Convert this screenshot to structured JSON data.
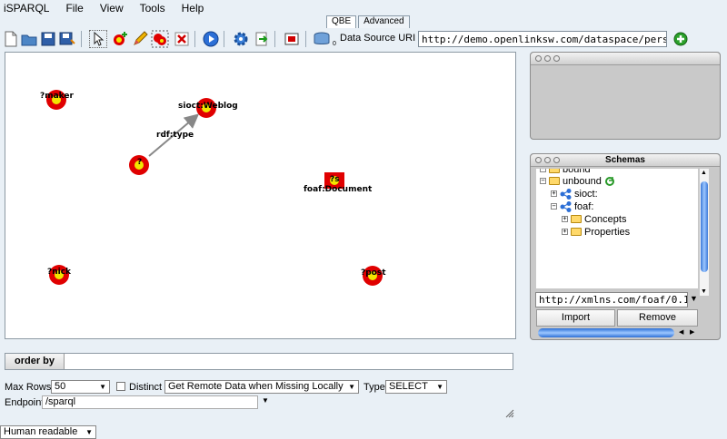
{
  "menu": [
    "iSPARQL",
    "File",
    "View",
    "Tools",
    "Help"
  ],
  "tabs": [
    {
      "label": "QBE"
    },
    {
      "label": "Advanced"
    }
  ],
  "toolbar": {
    "ds_label": "Data Source URI",
    "ds_uri": "http://demo.openlinksw.com/dataspace/person/dem",
    "ds_subscript": "0"
  },
  "graph": {
    "nodes": [
      {
        "label": "?maker"
      },
      {
        "label": "sioct:Weblog"
      },
      {
        "label": "?"
      },
      {
        "label": "?s"
      },
      {
        "label": "foaf:Document"
      },
      {
        "label": "?nick"
      },
      {
        "label": "?post"
      }
    ],
    "edge_label": "rdf:type"
  },
  "schemas": {
    "title": "Schemas",
    "tree": [
      {
        "label": "bound",
        "expander": "−",
        "partial": true
      },
      {
        "label": "unbound",
        "expander": "−"
      },
      {
        "label": "sioct:",
        "expander": "+"
      },
      {
        "label": "foaf:",
        "expander": "−"
      },
      {
        "label": "Concepts",
        "expander": "+"
      },
      {
        "label": "Properties",
        "expander": "+"
      }
    ],
    "ns_value": "http://xmlns.com/foaf/0.1/",
    "import_label": "Import",
    "remove_label": "Remove"
  },
  "orderby": {
    "label": "order by"
  },
  "options": {
    "max_rows_label": "Max Rows",
    "max_rows_value": "50",
    "distinct_label": "Distinct",
    "remote_value": "Get Remote Data when Missing Locally",
    "type_label": "Type",
    "type_value": "SELECT",
    "endpoint_label": "Endpoint",
    "endpoint_value": "/sparql"
  },
  "view": {
    "value": "Human readable"
  },
  "colors": {
    "node_red": "#e00000",
    "node_yellow": "#f2e600",
    "accent_blue": "#2c6fd6"
  }
}
